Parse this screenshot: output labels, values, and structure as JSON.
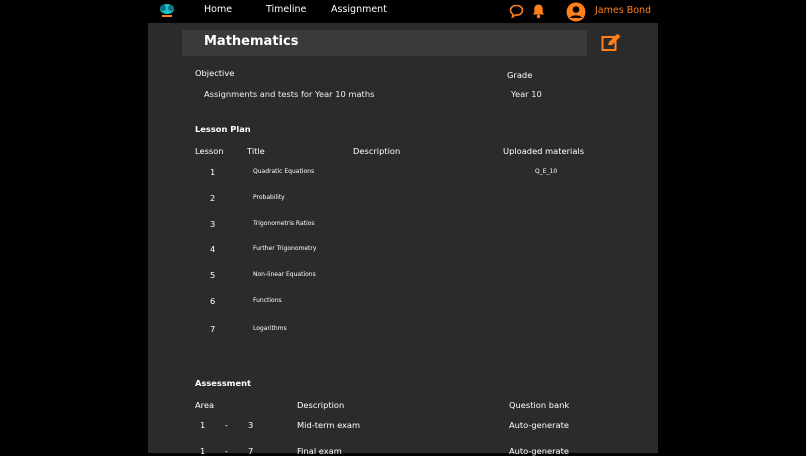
{
  "colors": {
    "accent": "#ff7f1a",
    "panel": "#2b2b2b",
    "title_bar": "#3a3a3a"
  },
  "nav": {
    "logo_icon": "school-logo-icon",
    "links": [
      "Home",
      "Timeline",
      "Assignment"
    ],
    "chat_icon": "chat-icon",
    "bell_icon": "bell-icon",
    "user_icon": "user-avatar-icon",
    "user_name": "James Bond"
  },
  "course": {
    "title": "Mathematics",
    "edit_icon": "edit-icon",
    "objective_label": "Objective",
    "objective": "Assignments and tests for Year 10 maths",
    "grade_label": "Grade",
    "grade": "Year 10"
  },
  "lesson_plan": {
    "heading": "Lesson Plan",
    "columns": [
      "Lesson",
      "Title",
      "Description",
      "Uploaded materials"
    ],
    "rows": [
      {
        "lesson": "1",
        "title": "Quadratic Equations",
        "description": "",
        "materials": "Q_E_10"
      },
      {
        "lesson": "2",
        "title": "Probability",
        "description": "",
        "materials": ""
      },
      {
        "lesson": "3",
        "title": "Trigonometris Ratios",
        "description": "",
        "materials": ""
      },
      {
        "lesson": "4",
        "title": "Further Trigonometry",
        "description": "",
        "materials": ""
      },
      {
        "lesson": "5",
        "title": "Non-linear Equations",
        "description": "",
        "materials": ""
      },
      {
        "lesson": "6",
        "title": "Functions",
        "description": "",
        "materials": ""
      },
      {
        "lesson": "7",
        "title": "Logarithms",
        "description": "",
        "materials": ""
      }
    ]
  },
  "assessment": {
    "heading": "Assessment",
    "columns": [
      "Area",
      "Description",
      "Question bank"
    ],
    "rows": [
      {
        "from": "1",
        "sep": "-",
        "to": "3",
        "description": "Mid-term exam",
        "bank": "Auto-generate"
      },
      {
        "from": "1",
        "sep": "-",
        "to": "7",
        "description": "Final exam",
        "bank": "Auto-generate"
      }
    ]
  }
}
